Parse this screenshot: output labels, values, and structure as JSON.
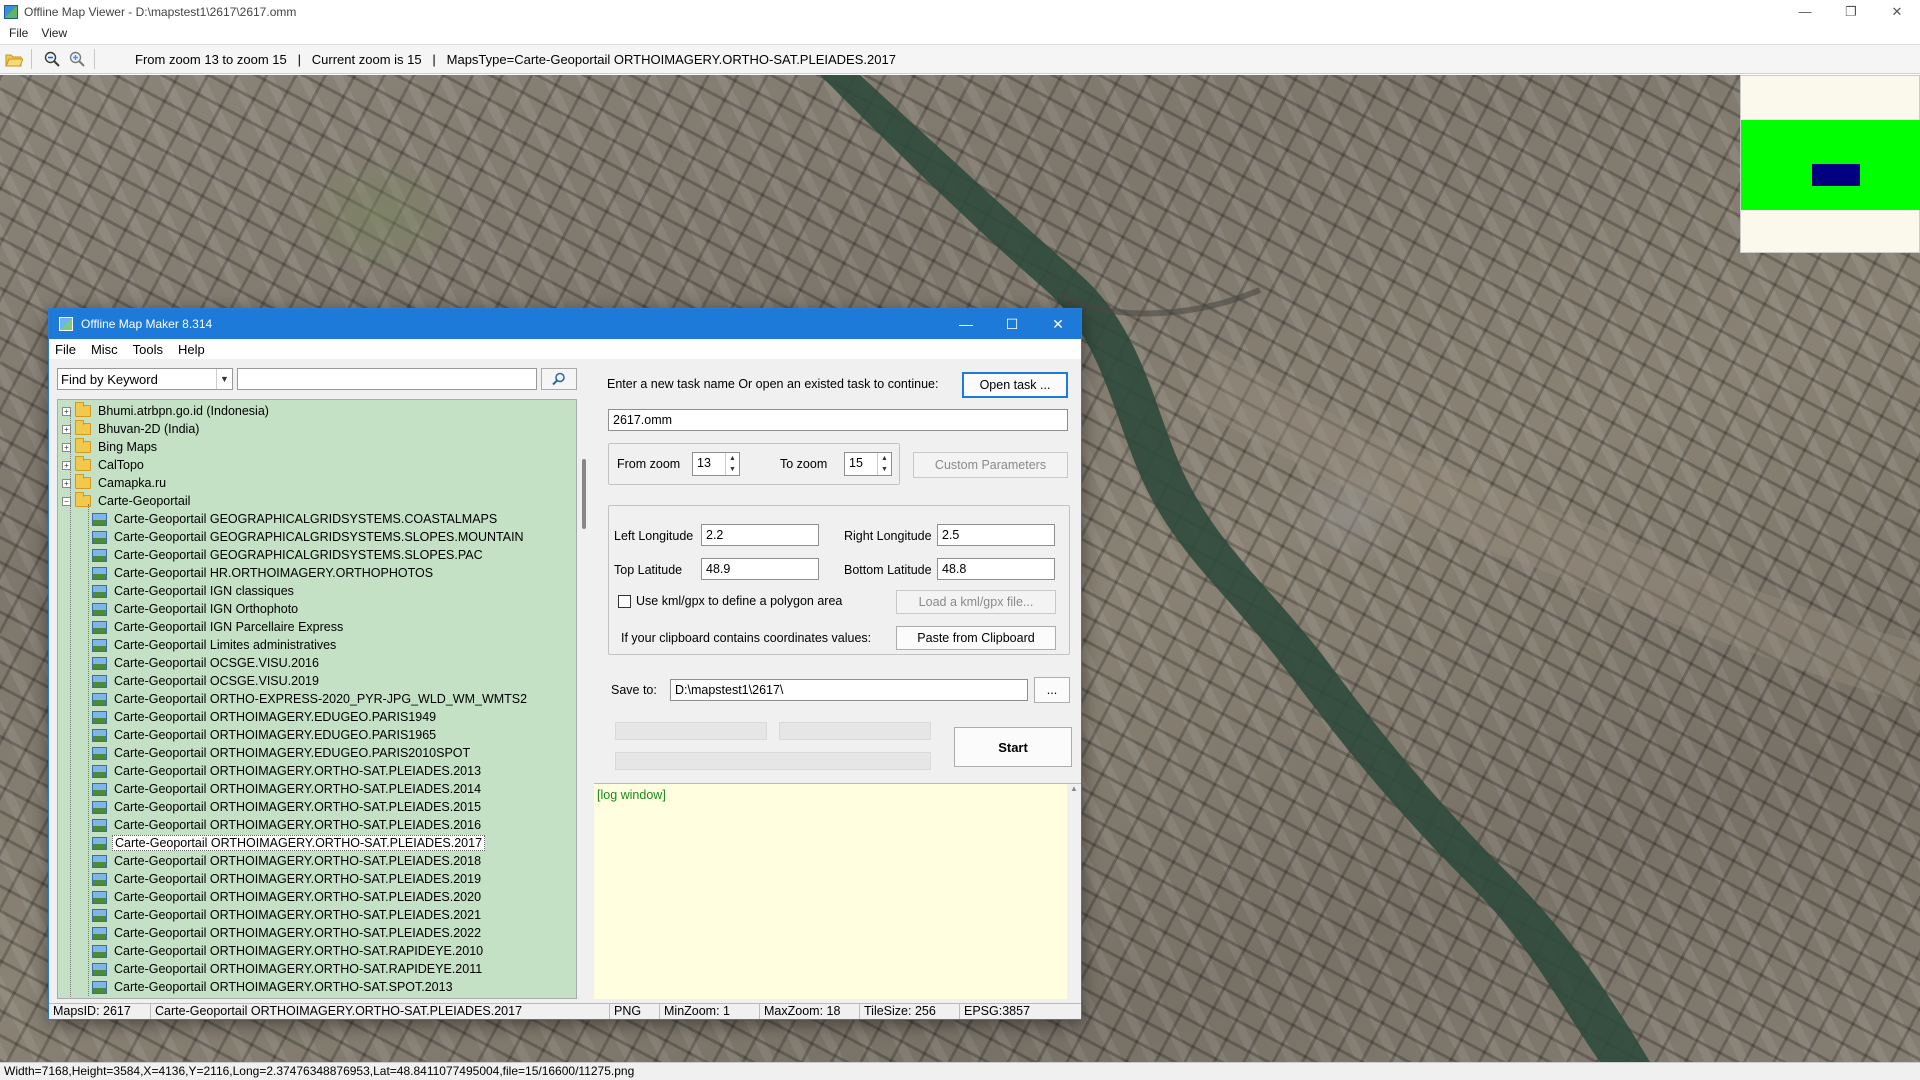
{
  "window": {
    "title": "Offline Map Viewer - D:\\mapstest1\\2617\\2617.omm",
    "controls": {
      "minimize": "—",
      "restore": "❐",
      "close": "✕"
    }
  },
  "menu": {
    "file": "File",
    "view": "View"
  },
  "toolbar": {
    "info": "From zoom 13 to zoom 15   |   Current zoom is 15   |   MapsType=Carte-Geoportail ORTHOIMAGERY.ORTHO-SAT.PLEIADES.2017",
    "icons": [
      "open-folder-icon",
      "zoom-out-icon",
      "zoom-in-icon"
    ]
  },
  "status_bar": {
    "text": "Width=7168,Height=3584,X=4136,Y=2116,Long=2.37476348876953,Lat=48.8411077495004,file=15/16600/11275.png"
  },
  "minimap": {
    "background": "#fbf8ec",
    "viewport": "#00ff00",
    "marker": "#000080"
  },
  "dialog": {
    "title": "Offline Map Maker 8.314",
    "controls": {
      "minimize": "—",
      "maximize": "☐",
      "close": "✕"
    },
    "menu": {
      "file": "File",
      "misc": "Misc",
      "tools": "Tools",
      "help": "Help"
    },
    "search": {
      "mode": "Find by Keyword",
      "query": ""
    },
    "tree": {
      "folders": [
        {
          "label": "Bhumi.atrbpn.go.id (Indonesia)",
          "expander": "+"
        },
        {
          "label": "Bhuvan-2D (India)",
          "expander": "+"
        },
        {
          "label": "Bing Maps",
          "expander": "+"
        },
        {
          "label": "CalTopo",
          "expander": "+"
        },
        {
          "label": "Camapka.ru",
          "expander": "+"
        },
        {
          "label": "Carte-Geoportail",
          "expander": "−"
        }
      ],
      "children": [
        "Carte-Geoportail GEOGRAPHICALGRIDSYSTEMS.COASTALMAPS",
        "Carte-Geoportail GEOGRAPHICALGRIDSYSTEMS.SLOPES.MOUNTAIN",
        "Carte-Geoportail GEOGRAPHICALGRIDSYSTEMS.SLOPES.PAC",
        "Carte-Geoportail HR.ORTHOIMAGERY.ORTHOPHOTOS",
        "Carte-Geoportail IGN classiques",
        "Carte-Geoportail IGN Orthophoto",
        "Carte-Geoportail IGN Parcellaire Express",
        "Carte-Geoportail Limites administratives",
        "Carte-Geoportail OCSGE.VISU.2016",
        "Carte-Geoportail OCSGE.VISU.2019",
        "Carte-Geoportail ORTHO-EXPRESS-2020_PYR-JPG_WLD_WM_WMTS2",
        "Carte-Geoportail ORTHOIMAGERY.EDUGEO.PARIS1949",
        "Carte-Geoportail ORTHOIMAGERY.EDUGEO.PARIS1965",
        "Carte-Geoportail ORTHOIMAGERY.EDUGEO.PARIS2010SPOT",
        "Carte-Geoportail ORTHOIMAGERY.ORTHO-SAT.PLEIADES.2013",
        "Carte-Geoportail ORTHOIMAGERY.ORTHO-SAT.PLEIADES.2014",
        "Carte-Geoportail ORTHOIMAGERY.ORTHO-SAT.PLEIADES.2015",
        "Carte-Geoportail ORTHOIMAGERY.ORTHO-SAT.PLEIADES.2016",
        "Carte-Geoportail ORTHOIMAGERY.ORTHO-SAT.PLEIADES.2017",
        "Carte-Geoportail ORTHOIMAGERY.ORTHO-SAT.PLEIADES.2018",
        "Carte-Geoportail ORTHOIMAGERY.ORTHO-SAT.PLEIADES.2019",
        "Carte-Geoportail ORTHOIMAGERY.ORTHO-SAT.PLEIADES.2020",
        "Carte-Geoportail ORTHOIMAGERY.ORTHO-SAT.PLEIADES.2021",
        "Carte-Geoportail ORTHOIMAGERY.ORTHO-SAT.PLEIADES.2022",
        "Carte-Geoportail ORTHOIMAGERY.ORTHO-SAT.RAPIDEYE.2010",
        "Carte-Geoportail ORTHOIMAGERY.ORTHO-SAT.RAPIDEYE.2011",
        "Carte-Geoportail ORTHOIMAGERY.ORTHO-SAT.SPOT.2013"
      ],
      "selected": "Carte-Geoportail ORTHOIMAGERY.ORTHO-SAT.PLEIADES.2017",
      "background": "#c5e1c5"
    },
    "task": {
      "prompt": "Enter a new task name Or open an existed task to continue:",
      "open_button": "Open task ...",
      "name": "2617.omm"
    },
    "zoom": {
      "from_label": "From zoom",
      "from_value": "13",
      "to_label": "To zoom",
      "to_value": "15",
      "custom_button": "Custom Parameters"
    },
    "coords": {
      "left_lon_label": "Left Longitude",
      "left_lon": "2.2",
      "right_lon_label": "Right Longitude",
      "right_lon": "2.5",
      "top_lat_label": "Top Latitude",
      "top_lat": "48.9",
      "bottom_lat_label": "Bottom Latitude",
      "bottom_lat": "48.8",
      "kml_label": "Use kml/gpx to define a polygon area",
      "kml_button": "Load a kml/gpx file...",
      "clipboard_label": "If your clipboard contains coordinates values:",
      "clipboard_button": "Paste from Clipboard"
    },
    "save": {
      "label": "Save to:",
      "path": "D:\\mapstest1\\2617\\",
      "browse": "..."
    },
    "start_button": "Start",
    "log": {
      "text": "[log window]",
      "background": "#ffffe0"
    },
    "status": {
      "maps_id": "MapsID: 2617",
      "maps_name": "Carte-Geoportail ORTHOIMAGERY.ORTHO-SAT.PLEIADES.2017",
      "format": "PNG",
      "min_zoom": "MinZoom: 1",
      "max_zoom": "MaxZoom: 18",
      "tile_size": "TileSize: 256",
      "epsg": "EPSG:3857"
    }
  }
}
